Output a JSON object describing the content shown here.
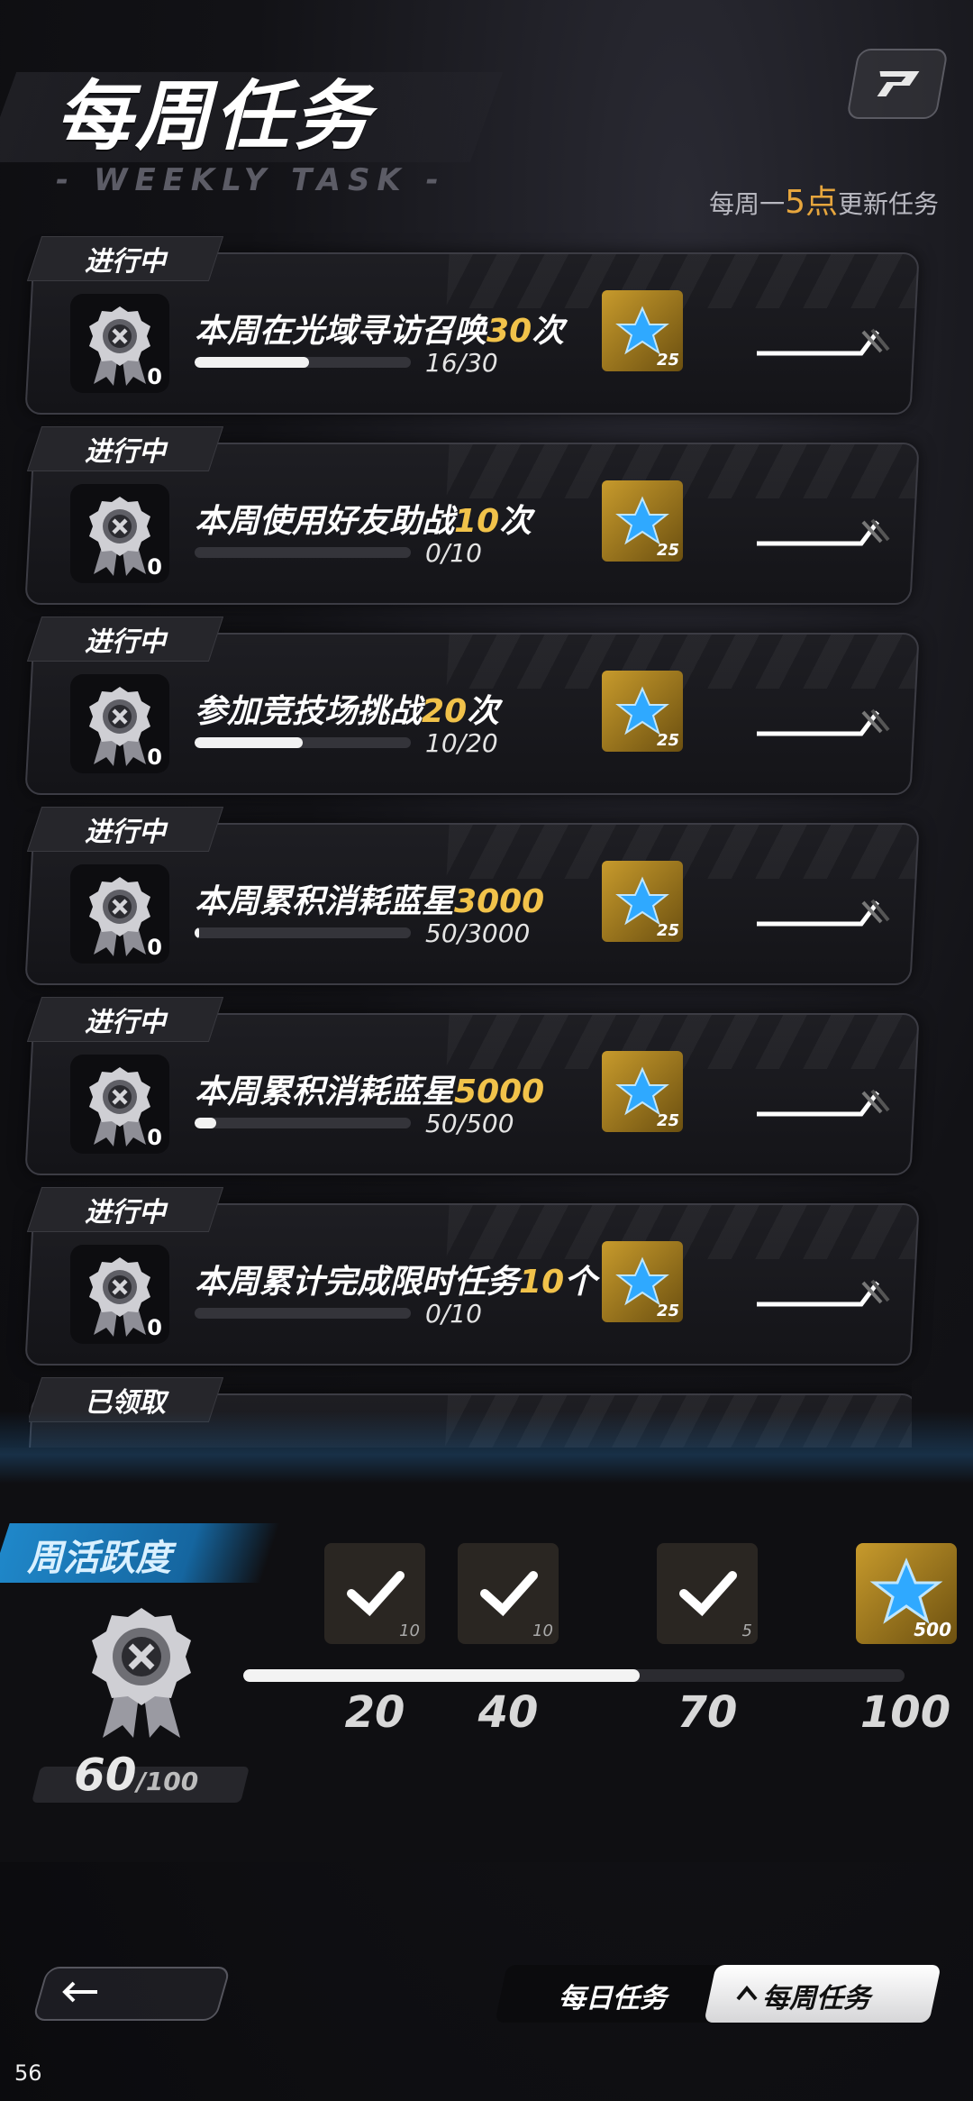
{
  "header": {
    "title": "每周任务",
    "subtitle": "- WEEKLY TASK -",
    "refresh_prefix": "每周一",
    "refresh_highlight": "5点",
    "refresh_suffix": "更新任务"
  },
  "tasks": [
    {
      "status": "进行中",
      "count": "0",
      "name_prefix": "本周在光域寻访召唤",
      "name_num": "30",
      "name_suffix": "次",
      "progress_text": "16/30",
      "progress": 0.53,
      "reward": "25"
    },
    {
      "status": "进行中",
      "count": "0",
      "name_prefix": "本周使用好友助战",
      "name_num": "10",
      "name_suffix": "次",
      "progress_text": "0/10",
      "progress": 0.0,
      "reward": "25"
    },
    {
      "status": "进行中",
      "count": "0",
      "name_prefix": "参加竞技场挑战",
      "name_num": "20",
      "name_suffix": "次",
      "progress_text": "10/20",
      "progress": 0.5,
      "reward": "25"
    },
    {
      "status": "进行中",
      "count": "0",
      "name_prefix": "本周累积消耗蓝星",
      "name_num": "3000",
      "name_suffix": "",
      "progress_text": "50/3000",
      "progress": 0.017,
      "reward": "25"
    },
    {
      "status": "进行中",
      "count": "0",
      "name_prefix": "本周累积消耗蓝星",
      "name_num": "5000",
      "name_suffix": "",
      "progress_text": "50/500",
      "progress": 0.1,
      "reward": "25"
    },
    {
      "status": "进行中",
      "count": "0",
      "name_prefix": "本周累计完成限时任务",
      "name_num": "10",
      "name_suffix": "个",
      "progress_text": "0/10",
      "progress": 0.0,
      "reward": "25"
    }
  ],
  "claimed_label": "已领取",
  "activity": {
    "title": "周活跃度",
    "score": "60",
    "score_max": "/100",
    "progress": 0.6,
    "milestones": [
      {
        "label": "20",
        "reward_count": "10"
      },
      {
        "label": "40",
        "reward_count": "10"
      },
      {
        "label": "70",
        "reward_count": "5"
      },
      {
        "label": "100",
        "reward_count": "500"
      }
    ]
  },
  "tabs": {
    "daily": "每日任务",
    "weekly": "每周任务"
  },
  "fps": "56"
}
